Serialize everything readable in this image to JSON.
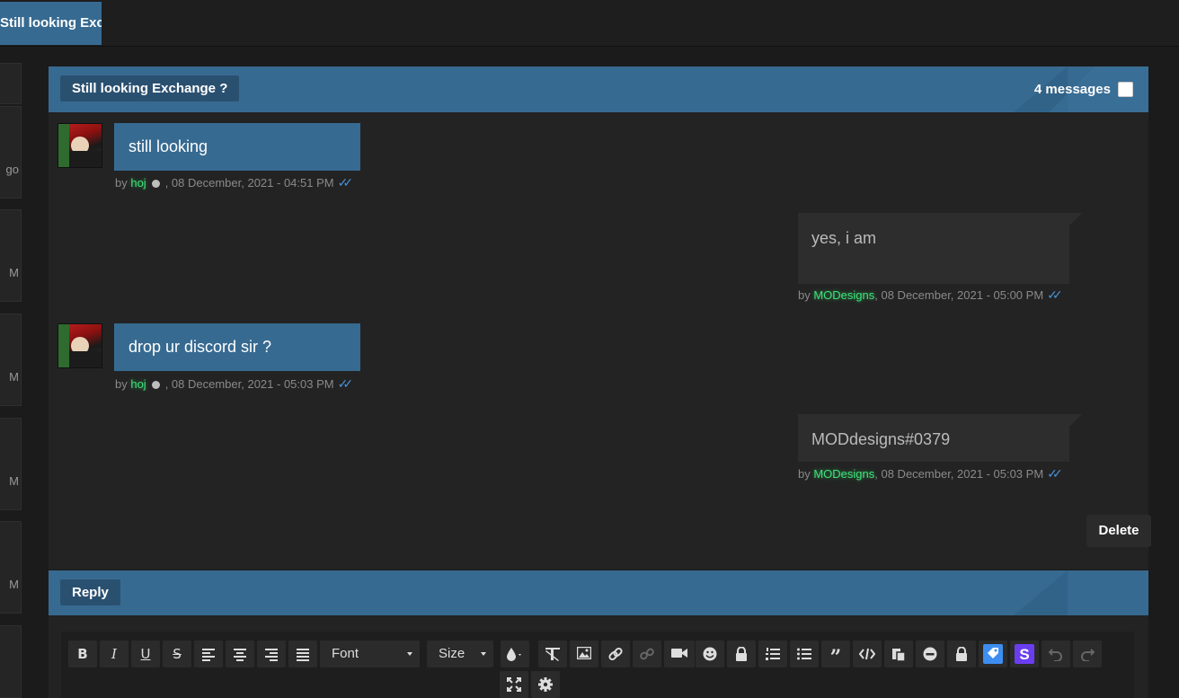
{
  "topbar": {
    "tab_title": "Still looking Exchange ?"
  },
  "sidebar_fragments": [
    "go",
    "M",
    "M",
    "M",
    "M"
  ],
  "conversation": {
    "title": "Still looking Exchange ?",
    "count_label": "4 messages",
    "messages": [
      {
        "text": "still looking",
        "by": "by ",
        "user": "hoj",
        "date": ", 08 December, 2021 - 04:51 PM",
        "side": "left"
      },
      {
        "text": "yes, i am",
        "by": "by ",
        "user": "MODesigns",
        "date": ", 08 December, 2021 - 05:00 PM",
        "side": "right"
      },
      {
        "text": "drop ur discord sir ?",
        "by": "by ",
        "user": "hoj",
        "date": ", 08 December, 2021 - 05:03 PM",
        "side": "left"
      },
      {
        "text": "MODdesigns#0379",
        "by": "by ",
        "user": "MODesigns",
        "date": ", 08 December, 2021 - 05:03 PM",
        "side": "right"
      }
    ],
    "delete_label": "Delete"
  },
  "reply": {
    "title": "Reply",
    "font_label": "Font",
    "size_label": "Size"
  },
  "colors": {
    "accent": "#376a91",
    "background": "#1b1b1b",
    "online_user": "#3de37a",
    "read_ticks": "#4a8fd6"
  }
}
